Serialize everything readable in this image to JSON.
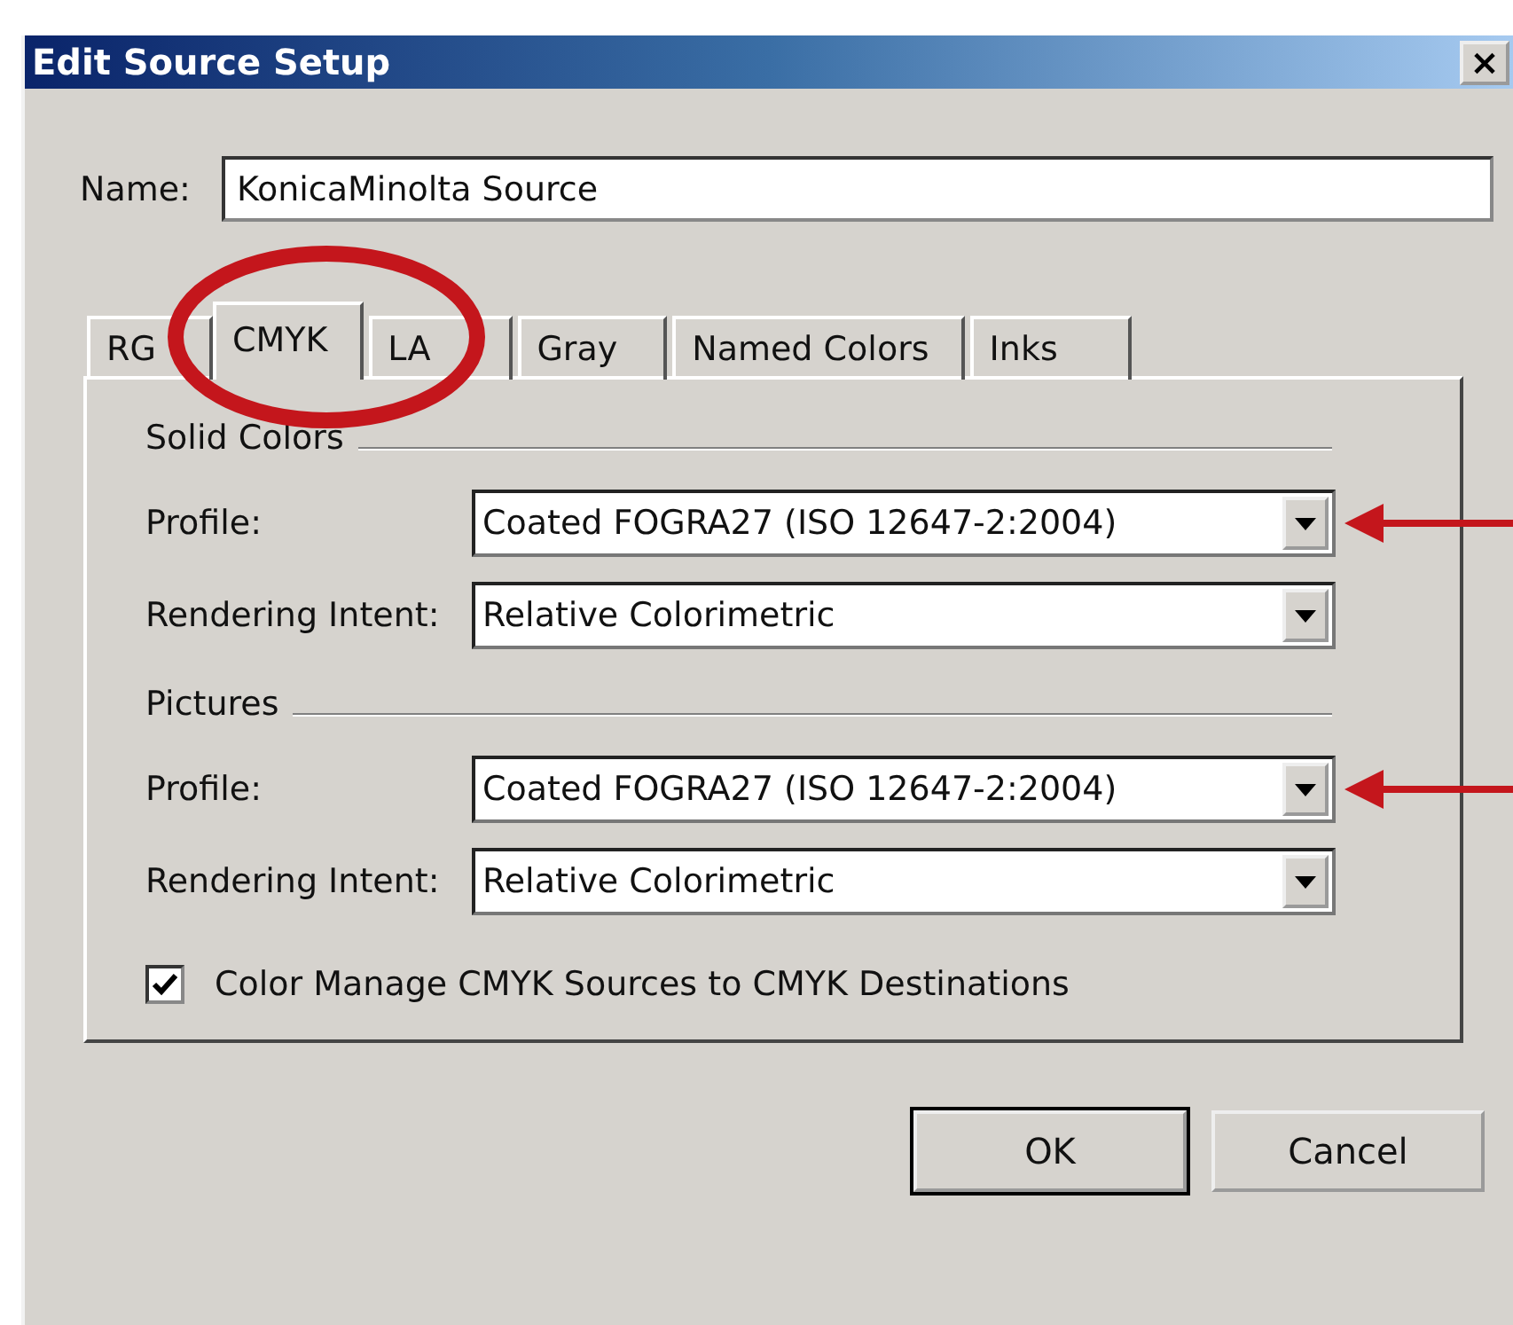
{
  "window": {
    "title": "Edit Source Setup",
    "close": "×"
  },
  "name_field": {
    "label": "Name:",
    "value": "KonicaMinolta Source"
  },
  "tabs": [
    {
      "label": "RG",
      "selected": false,
      "circled": false
    },
    {
      "label": "CMYK",
      "selected": true,
      "circled": true
    },
    {
      "label": "LA",
      "selected": false,
      "circled": false
    },
    {
      "label": "Gray",
      "selected": false,
      "circled": false
    },
    {
      "label": "Named Colors",
      "selected": false,
      "circled": false
    },
    {
      "label": "Inks",
      "selected": false,
      "circled": false
    }
  ],
  "groups": [
    {
      "title": "Solid Colors",
      "rows": [
        {
          "label": "Profile:",
          "value": "Coated FOGRA27 (ISO 12647-2:2004)",
          "arrow": true
        },
        {
          "label": "Rendering Intent:",
          "value": "Relative Colorimetric",
          "arrow": false
        }
      ]
    },
    {
      "title": "Pictures",
      "rows": [
        {
          "label": "Profile:",
          "value": "Coated FOGRA27 (ISO 12647-2:2004)",
          "arrow": true
        },
        {
          "label": "Rendering Intent:",
          "value": "Relative Colorimetric",
          "arrow": false
        }
      ]
    }
  ],
  "checkbox": {
    "label": "Color Manage CMYK Sources to CMYK Destinations",
    "checked": true
  },
  "buttons": [
    {
      "label": "OK",
      "default": true
    },
    {
      "label": "Cancel",
      "default": false
    }
  ]
}
